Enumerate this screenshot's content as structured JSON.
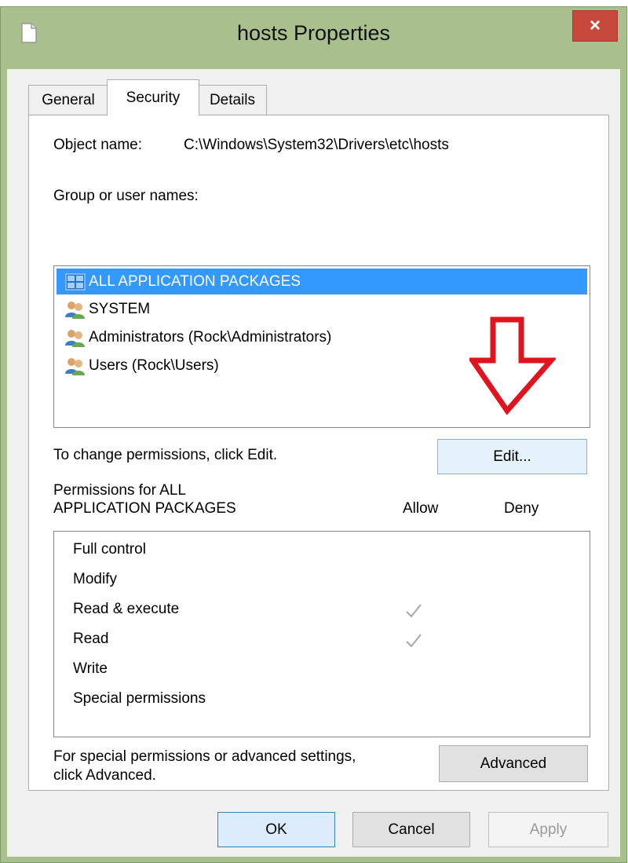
{
  "window": {
    "title": "hosts Properties",
    "close_label": "×"
  },
  "tabs": [
    {
      "label": "General",
      "active": false
    },
    {
      "label": "Security",
      "active": true
    },
    {
      "label": "Details",
      "active": false
    }
  ],
  "object": {
    "label": "Object name:",
    "value": "C:\\Windows\\System32\\Drivers\\etc\\hosts"
  },
  "groups": {
    "label": "Group or user names:",
    "items": [
      {
        "label": "ALL APPLICATION PACKAGES",
        "icon": "app-packages-icon",
        "selected": true
      },
      {
        "label": "SYSTEM",
        "icon": "users-icon",
        "selected": false
      },
      {
        "label": "Administrators (Rock\\Administrators)",
        "icon": "users-icon",
        "selected": false
      },
      {
        "label": "Users (Rock\\Users)",
        "icon": "users-icon",
        "selected": false
      }
    ]
  },
  "change": {
    "text": "To change permissions, click Edit.",
    "edit_label": "Edit..."
  },
  "permissions": {
    "header_line1": "Permissions for ALL",
    "header_line2": "APPLICATION PACKAGES",
    "allow_label": "Allow",
    "deny_label": "Deny",
    "rows": [
      {
        "label": "Full control",
        "allow": false,
        "deny": false
      },
      {
        "label": "Modify",
        "allow": false,
        "deny": false
      },
      {
        "label": "Read & execute",
        "allow": true,
        "deny": false
      },
      {
        "label": "Read",
        "allow": true,
        "deny": false
      },
      {
        "label": "Write",
        "allow": false,
        "deny": false
      },
      {
        "label": "Special permissions",
        "allow": false,
        "deny": false
      }
    ]
  },
  "advanced": {
    "text_line1": "For special permissions or advanced settings,",
    "text_line2": "click Advanced.",
    "button_label": "Advanced"
  },
  "footer": {
    "ok_label": "OK",
    "cancel_label": "Cancel",
    "apply_label": "Apply"
  },
  "colors": {
    "title_bar": "#a9c08e",
    "close_button": "#c7483d",
    "selection": "#3399ff",
    "annotation_arrow": "#e0141e"
  }
}
